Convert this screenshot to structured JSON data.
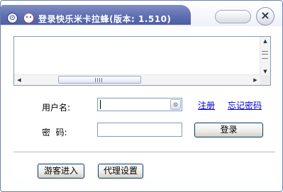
{
  "window": {
    "title": "登录快乐米卡拉蜂(版本: 1.510)",
    "close_glyph": "×",
    "menu_glyph": "⊙"
  },
  "log": {
    "vscroll_up": "▲",
    "vscroll_down": "▼",
    "hscroll_left": "◀",
    "hscroll_right": "▶"
  },
  "form": {
    "username_label": "用户名:",
    "username_value": "",
    "dropdown_glyph": "⊙",
    "password_label": "密  码:",
    "password_value": "",
    "register_link": "注册",
    "forgot_link": "忘记密码",
    "login_button": "登录"
  },
  "footer": {
    "guest_button": "游客进入",
    "proxy_button": "代理设置"
  },
  "colors": {
    "title_bar": "#5f6fb0",
    "link": "#0000cc",
    "border": "#7f9db9"
  }
}
